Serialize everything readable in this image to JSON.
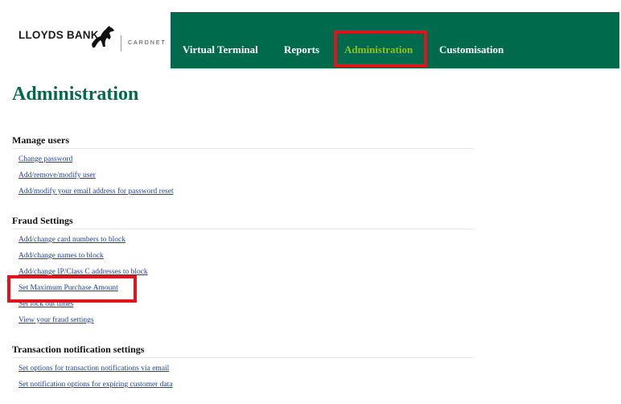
{
  "logo": {
    "brand": "LLOYDS BANK",
    "sub": "CARDNET"
  },
  "nav": {
    "items": [
      {
        "label": "Virtual Terminal"
      },
      {
        "label": "Reports"
      },
      {
        "label": "Administration"
      },
      {
        "label": "Customisation"
      }
    ],
    "active_color": "#94c11f",
    "bar_color": "#006a4d"
  },
  "page": {
    "title": "Administration"
  },
  "sections": [
    {
      "heading": "Manage users",
      "links": [
        "Change password",
        "Add/remove/modify user",
        "Add/modify your email address for password reset"
      ]
    },
    {
      "heading": "Fraud Settings",
      "links": [
        "Add/change card numbers to block",
        "Add/change names to block",
        "Add/change IP/Class C addresses to block",
        "Set Maximum Purchase Amount",
        "Set lock out times",
        "View your fraud settings"
      ]
    },
    {
      "heading": "Transaction notification settings",
      "links": [
        "Set options for transaction notifications via email",
        "Set notification options for expiring customer data"
      ]
    }
  ],
  "highlight_color": "#e0141e"
}
